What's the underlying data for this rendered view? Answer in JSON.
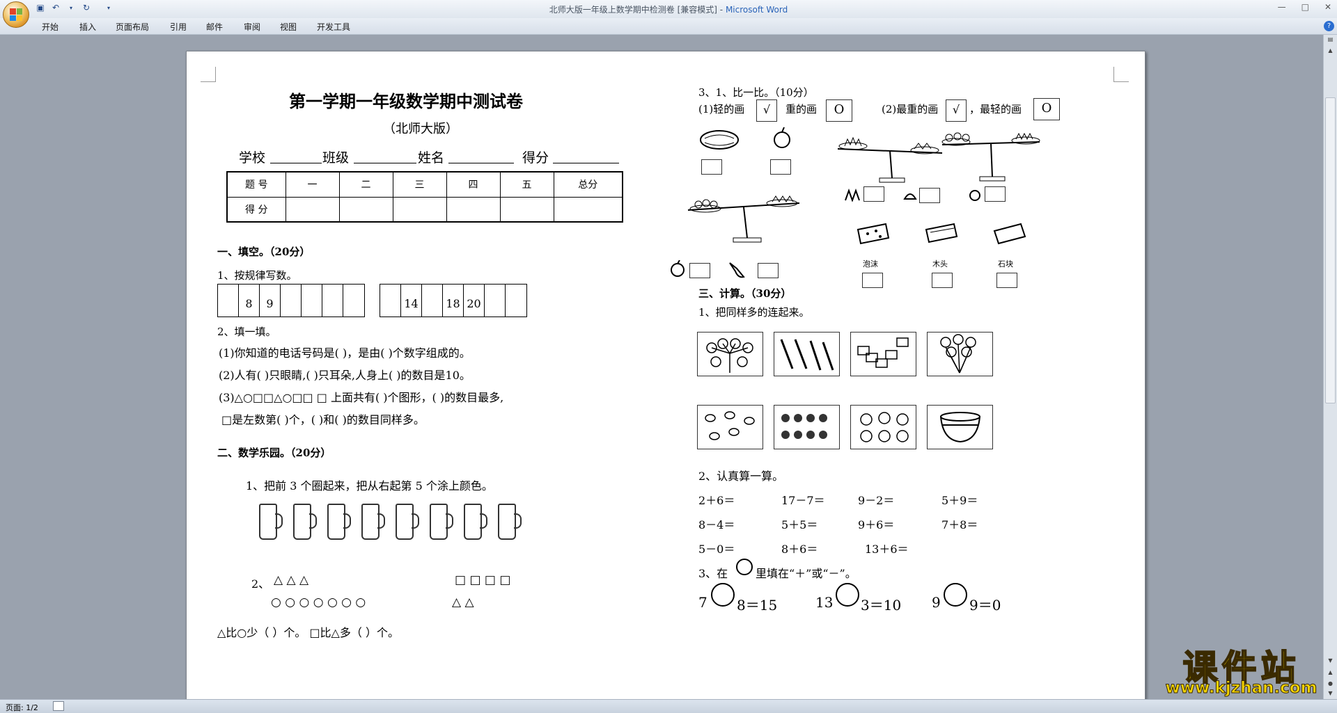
{
  "window": {
    "title": "北师大版一年级上数学期中检测卷 [兼容模式]",
    "app_name": "Microsoft Word",
    "title_sep": " - "
  },
  "ribbon": {
    "tabs": [
      "开始",
      "插入",
      "页面布局",
      "引用",
      "邮件",
      "审阅",
      "视图",
      "开发工具"
    ]
  },
  "status": {
    "page": "页面: 1/2"
  },
  "watermark": {
    "text": "课件站",
    "url": "www.kjzhan.com"
  },
  "doc": {
    "title": "第一学期一年级数学期中测试卷",
    "subtitle": "（北师大版）",
    "info": {
      "school": "学校",
      "class": "班级",
      "name": "姓名",
      "score": "得分"
    },
    "score_table": {
      "row1": [
        "题  号",
        "一",
        "二",
        "三",
        "四",
        "五",
        "总分"
      ],
      "row2": [
        "得  分",
        "",
        "",
        "",
        "",
        "",
        ""
      ]
    },
    "s1": {
      "heading": "一、填空。（20分）",
      "q1": "1、按规律写数。",
      "seq1": [
        "",
        "8",
        "9",
        "",
        "",
        "",
        ""
      ],
      "seq2": [
        "",
        "14",
        "",
        "18",
        "20",
        "",
        ""
      ],
      "q2": "2、填一填。",
      "l1": "(1)你知道的电话号码是(        )，是由(        )个数字组成的。",
      "l2": "(2)人有(         )只眼睛,(         )只耳朵,人身上(          )的数目是10。",
      "l3": "(3)△○□□△○□□ □  上面共有(       )个图形，(         )的数目最多,",
      "l4": "□是左数第(         )个，(          )和(          )的数目同样多。"
    },
    "s2": {
      "heading": "二、数学乐园。（20分）",
      "q1": "1、把前 3 个圈起来，把从右起第 5 个涂上颜色。",
      "q2_label": "2、",
      "tri_row": "△   △   △",
      "circ_row": "○   ○   ○   ○   ○   ○   ○",
      "sq_row": "□   □   □   □",
      "tri_row2": "△   △",
      "compare": "△比○少（     ）个。    □比△多（     ）个。"
    },
    "r3": {
      "heading": "3、1、比一比。（10分）",
      "light": "(1)轻的画",
      "heavy": "重的画",
      "check": "√",
      "circle": "O",
      "heaviest": "(2)最重的画",
      "lightest": "，最轻的画",
      "paomo": "泡沫",
      "mutou": "木头",
      "shikuai": "石块"
    },
    "s3": {
      "heading": "三、计算。（30分）",
      "q1": "1、把同样多的连起来。",
      "q2": "2、认真算一算。",
      "calc": [
        [
          "2＋6＝",
          "17－7＝",
          "9－2＝",
          "5＋9＝"
        ],
        [
          "8－4＝",
          "5＋5＝",
          "9＋6＝",
          "7＋8＝"
        ],
        [
          "5－0＝",
          "8＋6＝",
          "13＋6＝"
        ]
      ],
      "q3": "3、在",
      "q3b": "里填在“＋”或“－”。",
      "eq": [
        {
          "a": "7",
          "b": "8＝15"
        },
        {
          "a": "13",
          "b": "3＝10"
        },
        {
          "a": "9",
          "b": "9＝0"
        }
      ]
    }
  }
}
